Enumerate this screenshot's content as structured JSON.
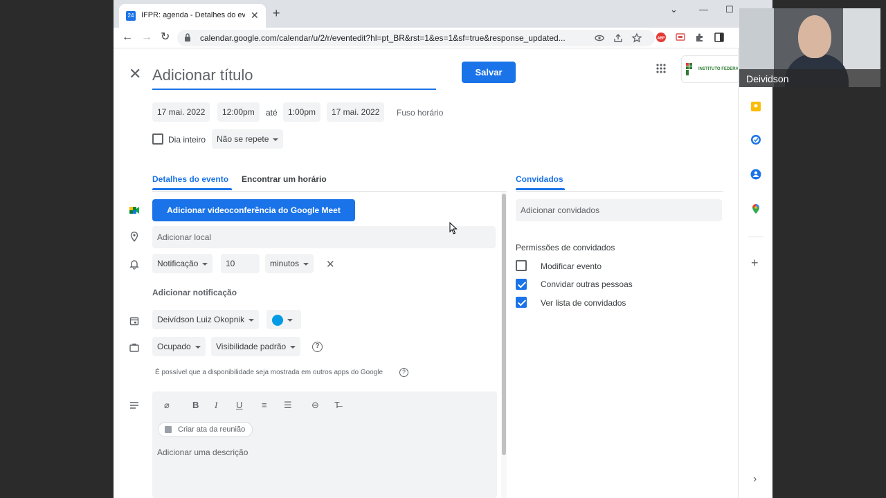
{
  "browser": {
    "tab_title": "IFPR: agenda - Detalhes do evento",
    "favicon_text": "24",
    "url": "calendar.google.com/calendar/u/2/r/eventedit?hl=pt_BR&rst=1&es=1&sf=true&response_updated...",
    "tab_close": "✕",
    "new_tab": "+",
    "minimize": "⌄",
    "restore": "—",
    "maximize": "☐",
    "back": "←",
    "forward": "→",
    "reload": "↻"
  },
  "event": {
    "title_placeholder": "Adicionar título",
    "close": "✕",
    "save_label": "Salvar",
    "org_logo_text": "INSTITUTO FEDERAL",
    "start_date": "17 mai. 2022",
    "start_time": "12:00pm",
    "until": "até",
    "end_time": "1:00pm",
    "end_date": "17 mai. 2022",
    "timezone": "Fuso horário",
    "all_day_label": "Dia inteiro",
    "recurrence": "Não se repete"
  },
  "tabs": {
    "details": "Detalhes do evento",
    "find_time": "Encontrar um horário",
    "guests": "Convidados"
  },
  "details": {
    "meet_button": "Adicionar videoconferência do Google Meet",
    "location_placeholder": "Adicionar local",
    "notification_type": "Notificação",
    "notification_value": "10",
    "notification_unit": "minutos",
    "remove": "✕",
    "add_notification": "Adicionar notificação",
    "calendar_owner": "Deivídson Luiz Okopnik",
    "busy_status": "Ocupado",
    "visibility": "Visibilidade padrão",
    "help": "?",
    "availability_note": "É possível que a disponibilidade seja mostrada em outros apps do Google",
    "create_notes": "Criar ata da reunião",
    "description_placeholder": "Adicionar uma descrição",
    "format": {
      "attach": "⌀",
      "bold": "B",
      "italic": "I",
      "underline": "U",
      "numbered": "≡",
      "bulleted": "☰",
      "link": "⊖",
      "clear": "T̶"
    }
  },
  "guests": {
    "add_placeholder": "Adicionar convidados",
    "permissions_title": "Permissões de convidados",
    "permissions": [
      {
        "label": "Modificar evento",
        "checked": false
      },
      {
        "label": "Convidar outras pessoas",
        "checked": true
      },
      {
        "label": "Ver lista de convidados",
        "checked": true
      }
    ]
  },
  "rail": {
    "add": "+",
    "expand": "›"
  },
  "webcam": {
    "name": "Deividson"
  },
  "colors": {
    "accent": "#1a73e8",
    "keep": "#fbbc04",
    "tasks": "#1a73e8",
    "contacts": "#1a73e8",
    "calendar_color": "#039be5"
  }
}
